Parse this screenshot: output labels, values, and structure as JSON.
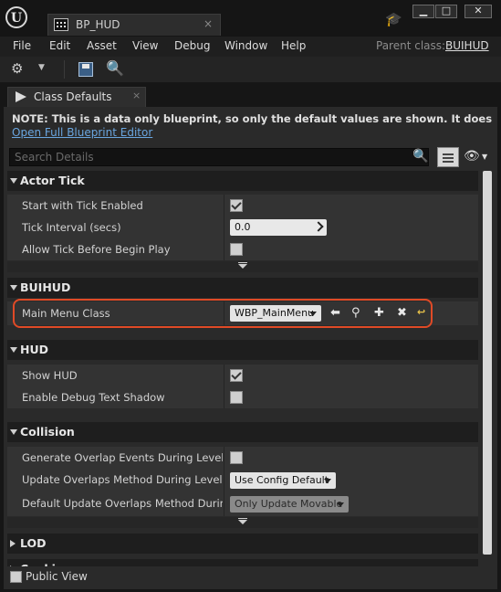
{
  "window": {
    "logo_text": "U",
    "doc_tab": "BP_HUD",
    "close_glyph": "×",
    "min_glyph": "▁",
    "max_glyph": "□",
    "win_close_glyph": "✕"
  },
  "menu": {
    "items": [
      "File",
      "Edit",
      "Asset",
      "View",
      "Debug",
      "Window",
      "Help"
    ],
    "parent_class_label": "Parent class:",
    "parent_class_value": "BUIHUD"
  },
  "toolbar": {
    "settings_icon": "settings-icon",
    "save_icon": "save-icon",
    "find_icon": "find-in-content-browser-icon"
  },
  "panel": {
    "tab_label": "Class Defaults",
    "tab_close": "×",
    "note": "NOTE: This is a data only blueprint, so only the default values are shown.  It does not have any scrip",
    "open_editor_link": "Open Full Blueprint Editor",
    "search_placeholder": "Search Details"
  },
  "categories": {
    "actor_tick": {
      "label": "Actor Tick",
      "rows": {
        "start_with_tick": {
          "name": "Start with Tick Enabled",
          "checked": true
        },
        "tick_interval": {
          "name": "Tick Interval (secs)",
          "value": "0.0"
        },
        "allow_tick_before": {
          "name": "Allow Tick Before Begin Play",
          "checked": false
        }
      }
    },
    "buihud": {
      "label": "BUIHUD",
      "rows": {
        "main_menu_class": {
          "name": "Main Menu Class",
          "value": "WBP_MainMenu"
        }
      }
    },
    "hud": {
      "label": "HUD",
      "rows": {
        "show_hud": {
          "name": "Show HUD",
          "checked": true
        },
        "debug_text_shadow": {
          "name": "Enable Debug Text Shadow",
          "checked": false
        }
      }
    },
    "collision": {
      "label": "Collision",
      "rows": {
        "overlap_events": {
          "name": "Generate Overlap Events During Level Streaming",
          "checked": false
        },
        "update_method": {
          "name": "Update Overlaps Method During Level Streaming",
          "value": "Use Config Default"
        },
        "default_update_method": {
          "name": "Default Update Overlaps Method During Level Streaming",
          "value": "Only Update Movable"
        }
      }
    },
    "lod": {
      "label": "LOD"
    },
    "cooking": {
      "label": "Cooking"
    }
  },
  "footer": {
    "public_view_label": "Public View"
  },
  "colors": {
    "highlight": "#e04a26",
    "link": "#6aa6e0"
  }
}
